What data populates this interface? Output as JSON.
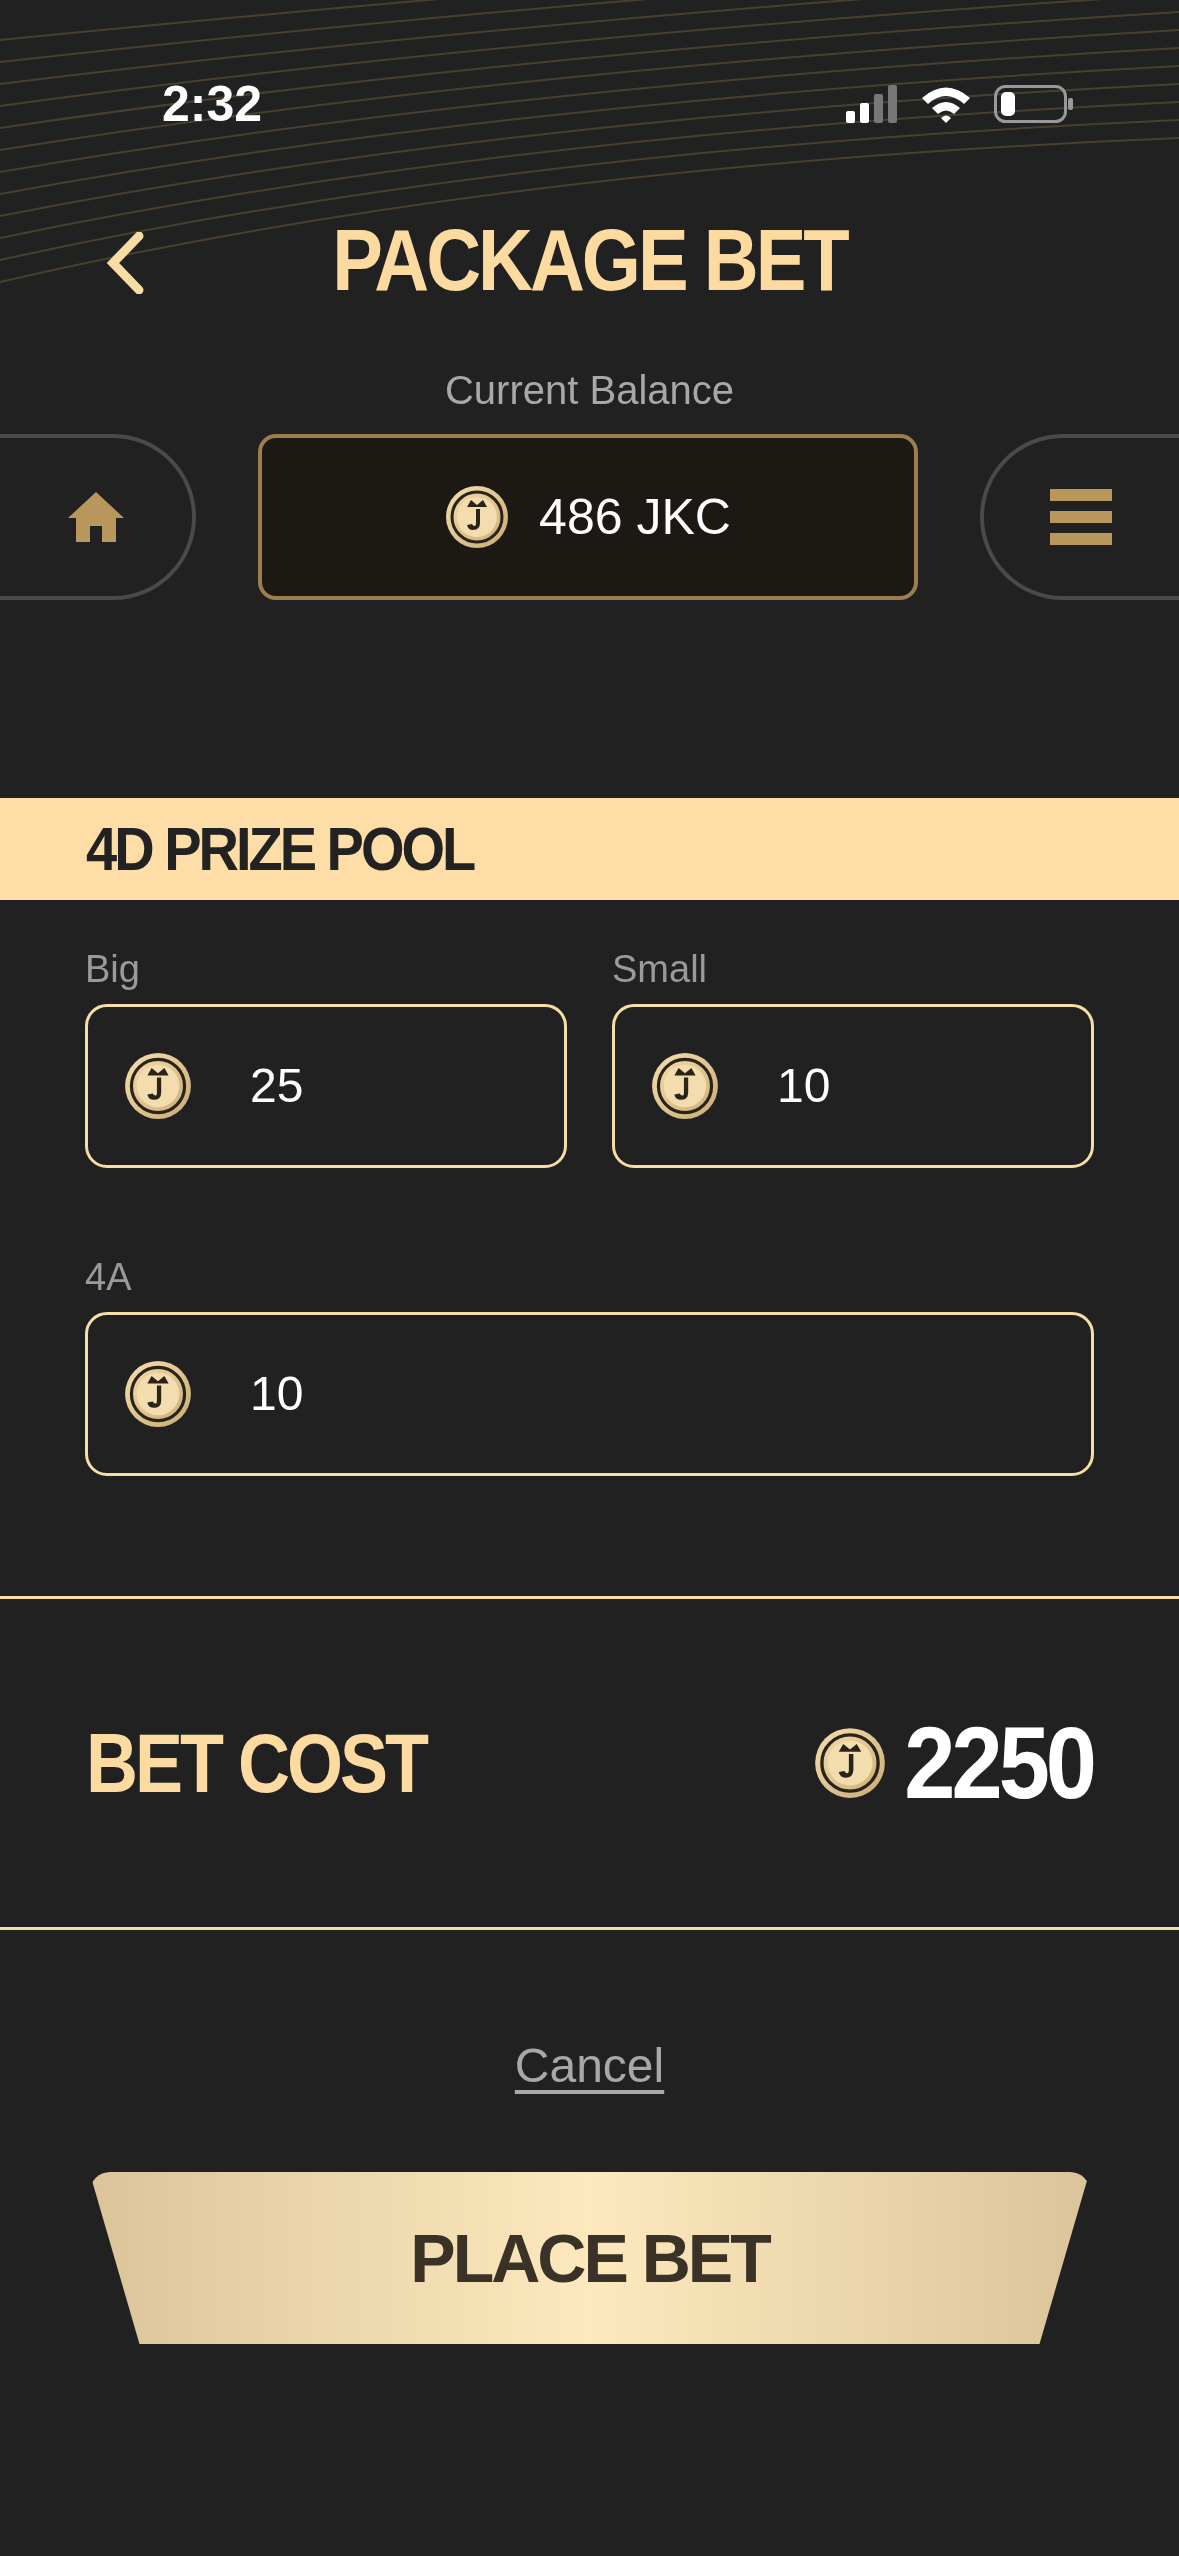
{
  "status_bar": {
    "time": "2:32"
  },
  "header": {
    "title": "PACKAGE BET"
  },
  "balance": {
    "label": "Current Balance",
    "value": "486 JKC"
  },
  "section": {
    "title": "4D PRIZE POOL"
  },
  "fields": [
    {
      "label": "Big",
      "value": "25",
      "kind": "half"
    },
    {
      "label": "Small",
      "value": "10",
      "kind": "half"
    },
    {
      "label": "4A",
      "value": "10",
      "kind": "full"
    }
  ],
  "bet_cost": {
    "label": "BET COST",
    "value": "2250"
  },
  "cancel": "Cancel",
  "place_bet": "PLACE BET"
}
